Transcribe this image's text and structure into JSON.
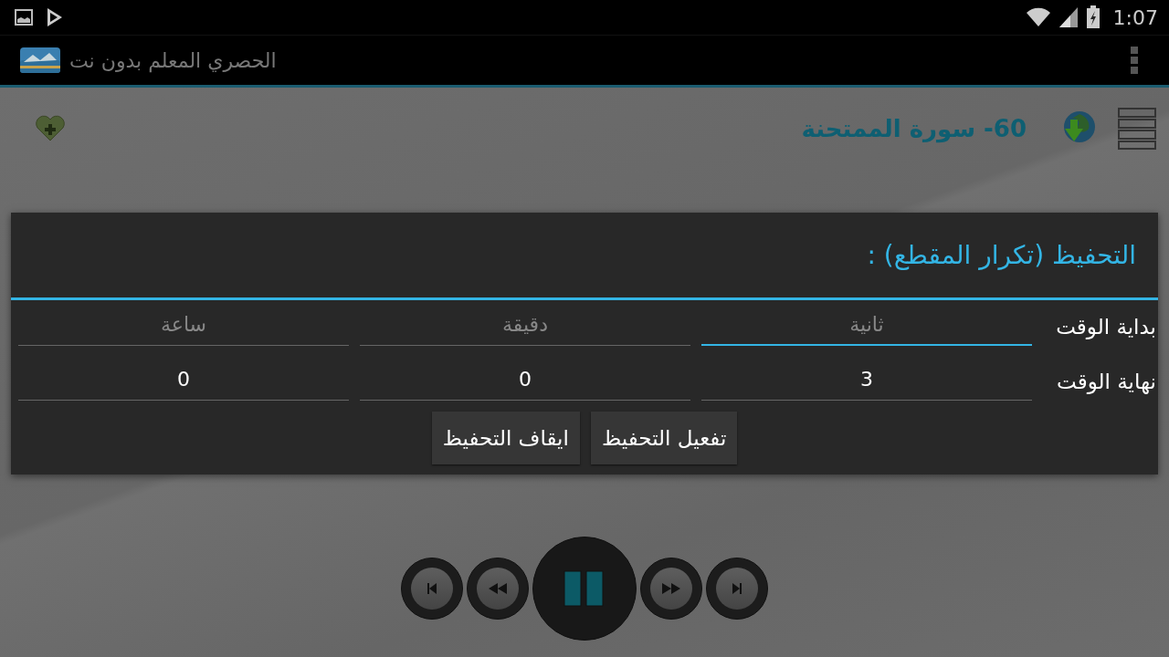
{
  "status_bar": {
    "time": "1:07"
  },
  "app_bar": {
    "title": "الحصري المعلم بدون نت"
  },
  "toolbar": {
    "title": "60- سورة الممتحنة"
  },
  "dialog": {
    "title": "التحفيظ (تكرار المقطع) :",
    "rows": [
      {
        "label": "بداية الوقت",
        "fields": [
          {
            "placeholder": "ثانية",
            "focused": true
          },
          {
            "placeholder": "دقيقة",
            "focused": false
          },
          {
            "placeholder": "ساعة",
            "focused": false
          }
        ]
      },
      {
        "label": "نهاية الوقت",
        "fields": [
          {
            "value": "3",
            "focused": false
          },
          {
            "value": "0",
            "focused": false
          },
          {
            "value": "0",
            "focused": false
          }
        ]
      }
    ],
    "buttons": [
      "تفعيل التحفيظ",
      "ايقاف التحفيظ"
    ]
  },
  "player": {
    "buttons": [
      {
        "kind": "previous"
      },
      {
        "kind": "rewind"
      },
      {
        "kind": "pause"
      },
      {
        "kind": "forward"
      },
      {
        "kind": "next"
      }
    ]
  }
}
